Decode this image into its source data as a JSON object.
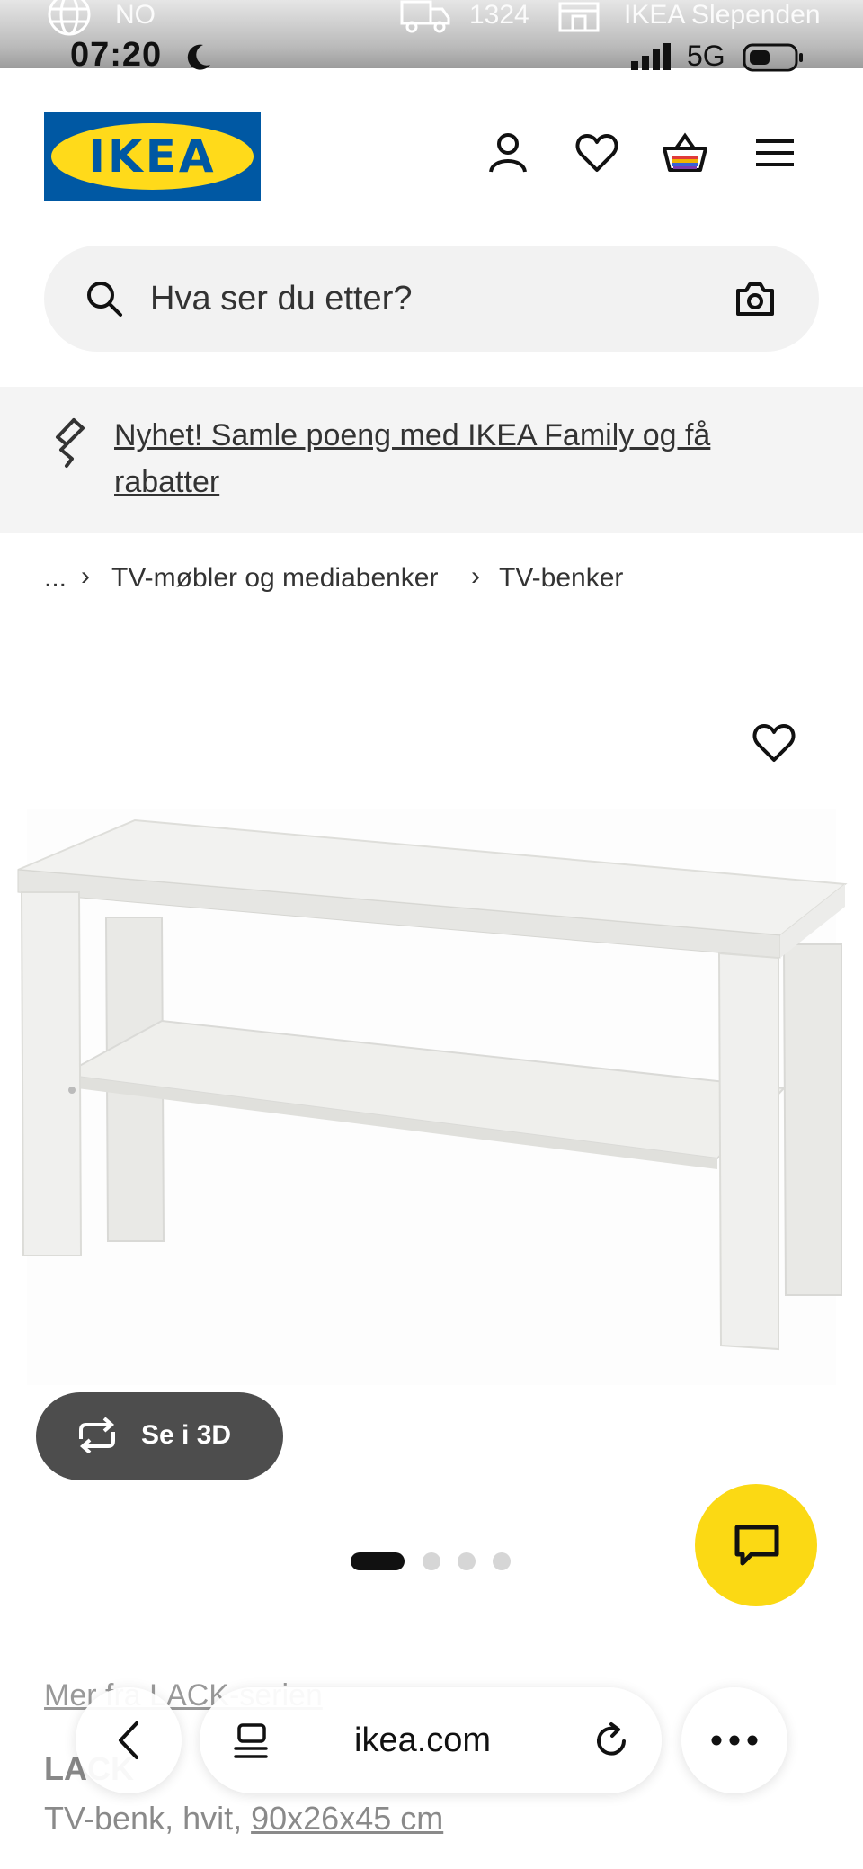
{
  "status_bar": {
    "region": "NO",
    "delivery_postcode": "1324",
    "store": "IKEA Slependen",
    "time": "07:20",
    "network": "5G"
  },
  "header": {
    "logo_text": "IKEA",
    "icons": [
      "person-icon",
      "heart-icon",
      "shopping-bag-icon",
      "menu-icon"
    ]
  },
  "search": {
    "placeholder": "Hva ser du etter?"
  },
  "promo": {
    "text": "Nyhet! Samle poeng med IKEA Family og få rabatter"
  },
  "breadcrumb": {
    "ellipsis": "...",
    "items": [
      "TV-møbler og mediabenker",
      "TV-benker"
    ]
  },
  "product": {
    "view_3d_label": "Se i 3D",
    "gallery_total": 4,
    "gallery_active": 1,
    "more_link": "Mer fra LACK-serien",
    "name": "LACK",
    "description": "TV-benk, hvit, ",
    "dimensions": "90x26x45 cm"
  },
  "browser": {
    "url": "ikea.com"
  },
  "colors": {
    "ikea_blue": "#0058a3",
    "ikea_yellow": "#ffda1a",
    "chat_yellow": "#fbd914",
    "dark_button": "#4d4d4d"
  }
}
